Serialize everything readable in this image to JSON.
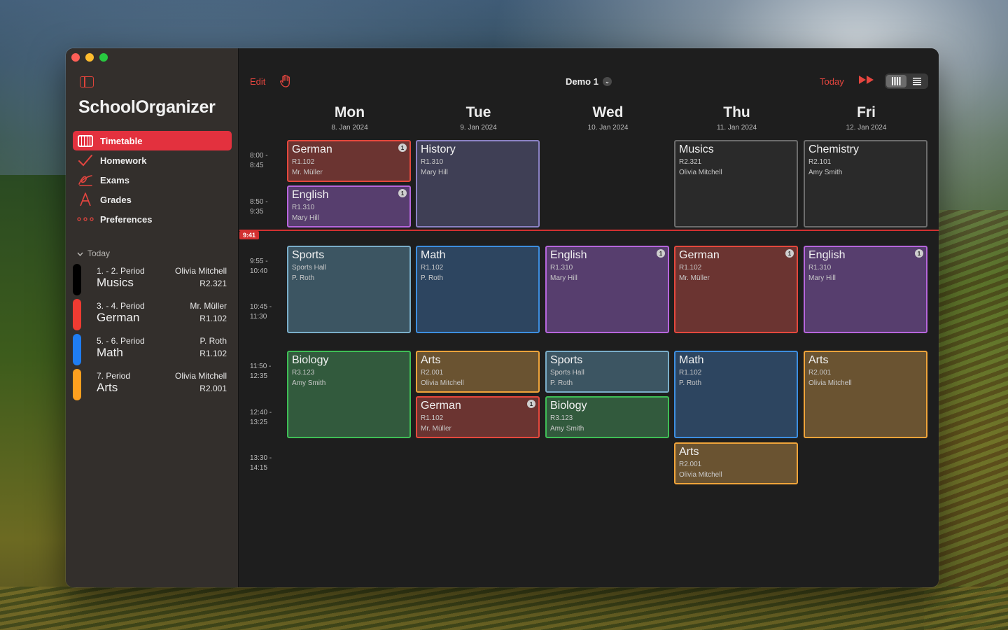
{
  "app": {
    "title": "SchoolOrganizer"
  },
  "sidebar": {
    "items": [
      {
        "label": "Timetable",
        "icon": "calendar-grid-icon",
        "active": true
      },
      {
        "label": "Homework",
        "icon": "checkmark-icon",
        "active": false
      },
      {
        "label": "Exams",
        "icon": "signature-icon",
        "active": false
      },
      {
        "label": "Grades",
        "icon": "grade-a-icon",
        "active": false
      },
      {
        "label": "Preferences",
        "icon": "ellipsis-icon",
        "active": false
      }
    ],
    "today_section": {
      "label": "Today",
      "entries": [
        {
          "period": "1. - 2. Period",
          "teacher": "Olivia Mitchell",
          "subject": "Musics",
          "room": "R2.321",
          "color": "#000000"
        },
        {
          "period": "3. - 4. Period",
          "teacher": "Mr. Müller",
          "subject": "German",
          "room": "R1.102",
          "color": "#ef3b32"
        },
        {
          "period": "5. - 6. Period",
          "teacher": "P. Roth",
          "subject": "Math",
          "room": "R1.102",
          "color": "#1f7df2"
        },
        {
          "period": "7. Period",
          "teacher": "Olivia Mitchell",
          "subject": "Arts",
          "room": "R2.001",
          "color": "#ffa01f"
        }
      ]
    }
  },
  "toolbar": {
    "edit_label": "Edit",
    "hand_icon": "hand-raised-icon",
    "title": "Demo 1",
    "today_label": "Today",
    "forward_icon": "fast-forward-icon",
    "view_modes": [
      "week-columns-icon",
      "list-rows-icon"
    ],
    "active_view": "week-columns-icon"
  },
  "accent_color": "#e6463f",
  "days": [
    {
      "name": "Mon",
      "date": "8. Jan 2024"
    },
    {
      "name": "Tue",
      "date": "9. Jan 2024"
    },
    {
      "name": "Wed",
      "date": "10. Jan 2024"
    },
    {
      "name": "Thu",
      "date": "11. Jan 2024"
    },
    {
      "name": "Fri",
      "date": "12. Jan 2024"
    }
  ],
  "time_slots": [
    {
      "start": "8:00 -",
      "end": "8:45"
    },
    {
      "start": "8:50 -",
      "end": "9:35"
    },
    {
      "start": "9:55 -",
      "end": "10:40"
    },
    {
      "start": "10:45 -",
      "end": "11:30"
    },
    {
      "start": "11:50 -",
      "end": "12:35"
    },
    {
      "start": "12:40 -",
      "end": "13:25"
    },
    {
      "start": "13:30 -",
      "end": "14:15"
    }
  ],
  "current_time": "9:41",
  "lessons": [
    {
      "day": 0,
      "period": 1,
      "span": 1,
      "subject": "German",
      "room": "R1.102",
      "teacher": "Mr. Müller",
      "color": "red",
      "badge": "1"
    },
    {
      "day": 0,
      "period": 2,
      "span": 1,
      "subject": "English",
      "room": "R1.310",
      "teacher": "Mary Hill",
      "color": "purple",
      "badge": "1"
    },
    {
      "day": 1,
      "period": 1,
      "span": 2,
      "subject": "History",
      "room": "R1.310",
      "teacher": "Mary Hill",
      "color": "slate",
      "badge": ""
    },
    {
      "day": 3,
      "period": 1,
      "span": 2,
      "subject": "Musics",
      "room": "R2.321",
      "teacher": "Olivia Mitchell",
      "color": "gray",
      "badge": ""
    },
    {
      "day": 4,
      "period": 1,
      "span": 2,
      "subject": "Chemistry",
      "room": "R2.101",
      "teacher": "Amy Smith",
      "color": "gray",
      "badge": ""
    },
    {
      "day": 0,
      "period": 3,
      "span": 2,
      "subject": "Sports",
      "room": "Sports Hall",
      "teacher": "P. Roth",
      "color": "teal",
      "badge": ""
    },
    {
      "day": 1,
      "period": 3,
      "span": 2,
      "subject": "Math",
      "room": "R1.102",
      "teacher": "P. Roth",
      "color": "blue",
      "badge": ""
    },
    {
      "day": 2,
      "period": 3,
      "span": 2,
      "subject": "English",
      "room": "R1.310",
      "teacher": "Mary Hill",
      "color": "purple",
      "badge": "1"
    },
    {
      "day": 3,
      "period": 3,
      "span": 2,
      "subject": "German",
      "room": "R1.102",
      "teacher": "Mr. Müller",
      "color": "red",
      "badge": "1"
    },
    {
      "day": 4,
      "period": 3,
      "span": 2,
      "subject": "English",
      "room": "R1.310",
      "teacher": "Mary Hill",
      "color": "purple",
      "badge": "1"
    },
    {
      "day": 0,
      "period": 5,
      "span": 2,
      "subject": "Biology",
      "room": "R3.123",
      "teacher": "Amy Smith",
      "color": "green",
      "badge": ""
    },
    {
      "day": 1,
      "period": 5,
      "span": 1,
      "subject": "Arts",
      "room": "R2.001",
      "teacher": "Olivia Mitchell",
      "color": "orange",
      "badge": ""
    },
    {
      "day": 1,
      "period": 6,
      "span": 1,
      "subject": "German",
      "room": "R1.102",
      "teacher": "Mr. Müller",
      "color": "red",
      "badge": "1"
    },
    {
      "day": 2,
      "period": 5,
      "span": 1,
      "subject": "Sports",
      "room": "Sports Hall",
      "teacher": "P. Roth",
      "color": "teal",
      "badge": ""
    },
    {
      "day": 2,
      "period": 6,
      "span": 1,
      "subject": "Biology",
      "room": "R3.123",
      "teacher": "Amy Smith",
      "color": "green",
      "badge": ""
    },
    {
      "day": 3,
      "period": 5,
      "span": 2,
      "subject": "Math",
      "room": "R1.102",
      "teacher": "P. Roth",
      "color": "blue",
      "badge": ""
    },
    {
      "day": 4,
      "period": 5,
      "span": 2,
      "subject": "Arts",
      "room": "R2.001",
      "teacher": "Olivia Mitchell",
      "color": "orange",
      "badge": ""
    },
    {
      "day": 3,
      "period": 7,
      "span": 1,
      "subject": "Arts",
      "room": "R2.001",
      "teacher": "Olivia Mitchell",
      "color": "orange",
      "badge": ""
    }
  ]
}
